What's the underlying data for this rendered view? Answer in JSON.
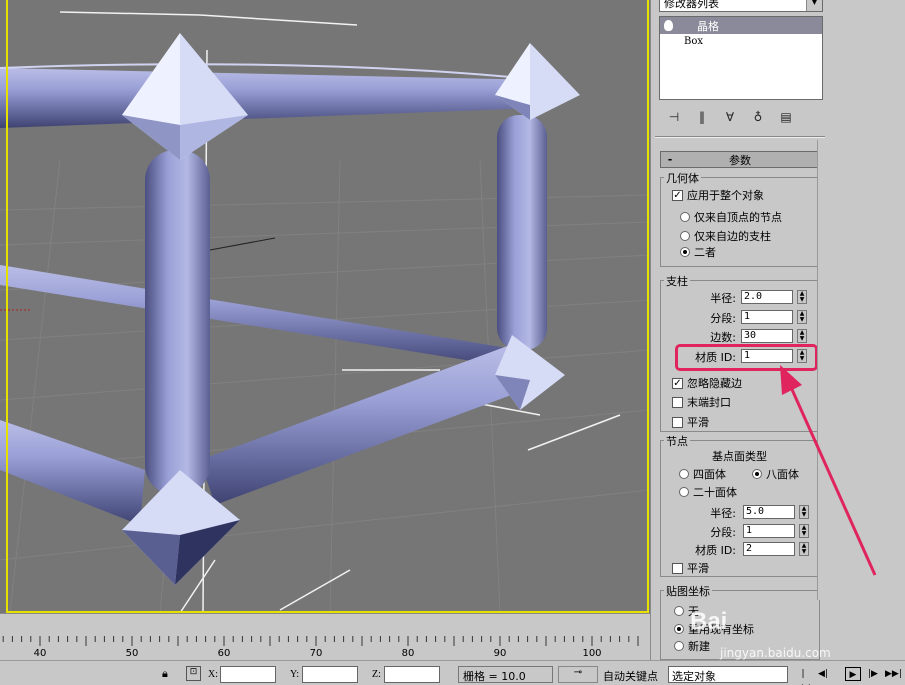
{
  "modifier_list": {
    "label": "修改器列表"
  },
  "stack": {
    "items": [
      {
        "label": "晶格",
        "selected": true
      },
      {
        "label": "Box",
        "selected": false
      }
    ]
  },
  "stack_tools": [
    "pin-icon",
    "show-end-result-icon",
    "make-unique-icon",
    "remove-modifier-icon",
    "configure-icon"
  ],
  "rollout": {
    "toggle": "-",
    "title": "参数"
  },
  "geometry": {
    "title": "几何体",
    "apply_whole": "应用于整个对象",
    "apply_whole_checked": true,
    "options": [
      "仅来自顶点的节点",
      "仅来自边的支柱",
      "二者"
    ],
    "selected_option": 2
  },
  "struts": {
    "title": "支柱",
    "radius_label": "半径:",
    "radius_value": "2.0",
    "segments_label": "分段:",
    "segments_value": "1",
    "sides_label": "边数:",
    "sides_value": "30",
    "matid_label": "材质 ID:",
    "matid_value": "1",
    "ignore_hidden": "忽略隐藏边",
    "ignore_hidden_checked": true,
    "end_caps": "末端封口",
    "end_caps_checked": false,
    "smooth": "平滑",
    "smooth_checked": false
  },
  "joints": {
    "title": "节点",
    "base_type": "基点面类型",
    "types": [
      "四面体",
      "八面体",
      "二十面体"
    ],
    "selected_type": 1,
    "radius_label": "半径:",
    "radius_value": "5.0",
    "segments_label": "分段:",
    "segments_value": "1",
    "matid_label": "材质 ID:",
    "matid_value": "2",
    "smooth": "平滑",
    "smooth_checked": false
  },
  "mapping": {
    "title": "贴图坐标",
    "options": [
      "无",
      "重用现有坐标",
      "新建"
    ],
    "selected_option": 1
  },
  "ruler": {
    "ticks": [
      "40",
      "50",
      "60",
      "70",
      "80",
      "90",
      "100"
    ]
  },
  "statusbar": {
    "x_label": "X:",
    "y_label": "Y:",
    "z_label": "Z:",
    "grid_text": "栅格 = 10.0",
    "autokey": "自动关键点",
    "selection": "选定对象"
  },
  "colors": {
    "viewport_bg": "#767676",
    "lattice": "#8c91c8",
    "highlight": "#e0245e",
    "active_border": "#e8e100"
  },
  "watermark": {
    "logo": "Bai",
    "site": "jingyan.baidu.com"
  }
}
